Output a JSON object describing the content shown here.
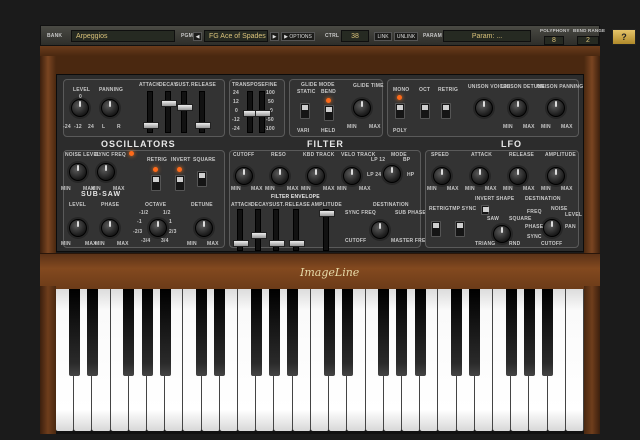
{
  "topbar": {
    "bank_label": "BANK",
    "bank_value": "Arpeggios",
    "pgm_label": "PGM",
    "pgm_value": "FG Ace of Spades",
    "options_label": "OPTIONS",
    "ctrl_label": "CTRL",
    "ctrl_value": "38",
    "link_label": "LINK",
    "unlink_label": "UNLINK",
    "param_label": "PARAM",
    "param_value": "Param: ...",
    "polyphony_label": "POLYPHONY",
    "polyphony_value": "8",
    "bend_range_label": "BEND RANGE",
    "bend_range_value": "2",
    "help_label": "?"
  },
  "sections": {
    "oscillators": "OSCILLATORS",
    "filter": "FILTER",
    "lfo": "LFO",
    "sub_saw": "SUB-SAW",
    "filter_envelope": "FILTER ENVELOPE"
  },
  "master": {
    "level": "LEVEL",
    "panning": "PANNING",
    "attack": "ATTACK",
    "decay": "DECAY",
    "sust": "SUST.",
    "release": "RELEASE",
    "transpose": "TRANSPOSE",
    "fine": "FINE",
    "glide_mode": "GLIDE MODE",
    "static": "STATIC",
    "bend": "BEND",
    "vari": "VARI",
    "held": "HELD",
    "glide_time": "GLIDE TIME",
    "min": "MIN",
    "max": "MAX",
    "mono": "MONO",
    "poly": "POLY",
    "oct": "OCT",
    "retrig": "RETRIG",
    "unison_voices": "UNISON VOICES",
    "unison_detune": "UNISON DETUNE",
    "unison_panning": "UNISON PANNING",
    "lvl_ticks": [
      "-24",
      "-12",
      "0",
      "24"
    ],
    "pan_ticks": [
      "L",
      "R"
    ],
    "transpose_ticks": [
      "24",
      "12",
      "0",
      "-12",
      "-24"
    ],
    "fine_ticks": [
      "100",
      "50",
      "0",
      "-50",
      "-100"
    ]
  },
  "osc": {
    "noise_level": "NOISE LEVEL",
    "sync_freq": "SYNC FREQ",
    "retrig": "RETRIG",
    "invert": "INVERT",
    "square": "SQUARE",
    "level": "LEVEL",
    "phase": "PHASE",
    "octave": "OCTAVE",
    "detune": "DETUNE",
    "octave_ticks": [
      "-1/2",
      "1/2",
      "-1",
      "1",
      "-2/3",
      "2/3",
      "-3/4",
      "3/4"
    ]
  },
  "filt": {
    "cutoff": "CUTOFF",
    "reso": "RESO",
    "kbd_track": "KBD TRACK",
    "velo_track": "VELO TRACK",
    "mode": "MODE",
    "lp12": "LP 12",
    "bp": "BP",
    "lp24": "LP 24",
    "hp": "HP",
    "attack": "ATTACK",
    "decay": "DECAY",
    "sust": "SUST.",
    "release": "RELEASE",
    "amplitude": "AMPLITUDE",
    "destination": "DESTINATION",
    "sync_freq": "SYNC FREQ",
    "sub_phase": "SUB PHASE",
    "cutoff2": "CUTOFF",
    "master_freq": "MASTER FREQ"
  },
  "lfo": {
    "speed": "SPEED",
    "attack": "ATTACK",
    "release": "RELEASE",
    "amplitude": "AMPLITUDE",
    "retrig": "RETRIG",
    "tmp_sync": "TMP SYNC",
    "invert_shape": "INVERT SHAPE",
    "saw": "SAW",
    "square": "SQUARE",
    "triang": "TRIANG",
    "rnd": "RND",
    "destination": "DESTINATION",
    "freq": "FREQ",
    "noise": "NOISE",
    "level": "LEVEL",
    "phase": "PHASE",
    "pan": "PAN",
    "sync": "SYNC",
    "cutoff": "CUTOFF"
  },
  "brand": "ImageLine"
}
